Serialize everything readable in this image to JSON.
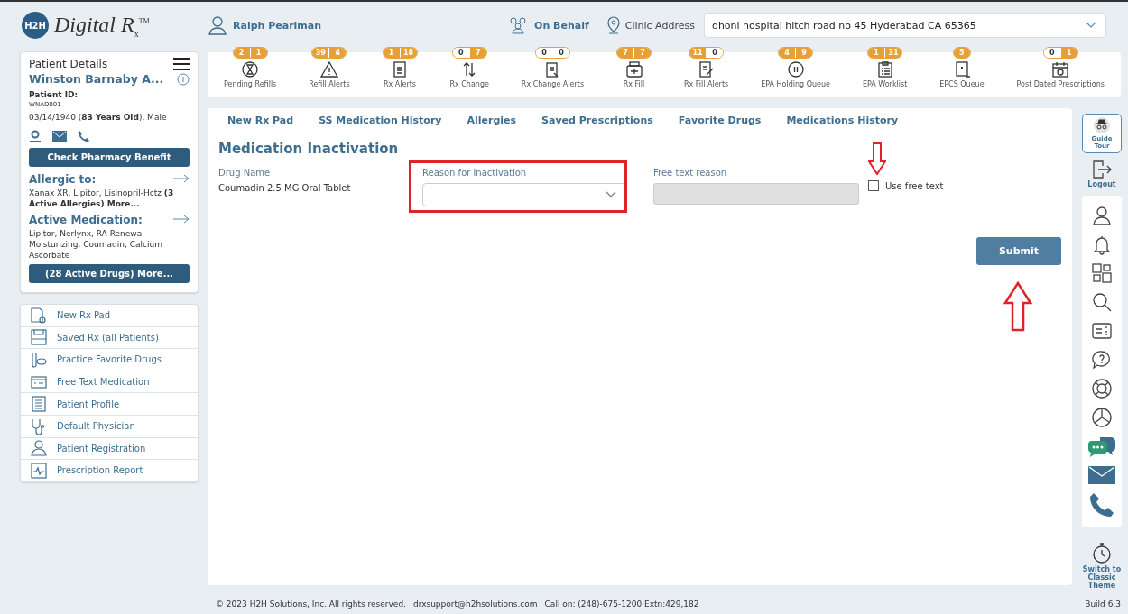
{
  "header": {
    "logo": {
      "badge": "H2H",
      "name": "Digital R",
      "sub": "x",
      "tm": "TM"
    },
    "user": "Ralph Pearlman",
    "on_behalf": "On Behalf",
    "clinic_label": "Clinic Address",
    "clinic": "dhoni hospital hitch road no 45 Hyderabad CA 65365"
  },
  "queues": [
    {
      "label": "Pending Refills",
      "counts": [
        {
          "value": "2",
          "highlighted": true
        },
        {
          "value": "1",
          "highlighted": true
        }
      ]
    },
    {
      "label": "Refill Alerts",
      "counts": [
        {
          "value": "39",
          "highlighted": true
        },
        {
          "value": "4",
          "highlighted": true
        }
      ]
    },
    {
      "label": "Rx Alerts",
      "counts": [
        {
          "value": "1",
          "highlighted": true
        },
        {
          "value": "18",
          "highlighted": true
        }
      ]
    },
    {
      "label": "Rx Change",
      "counts": [
        {
          "value": "0",
          "highlighted": false
        },
        {
          "value": "7",
          "highlighted": true
        }
      ]
    },
    {
      "label": "Rx Change Alerts",
      "counts": [
        {
          "value": "0",
          "highlighted": false
        },
        {
          "value": "0",
          "highlighted": false
        }
      ]
    },
    {
      "label": "Rx Fill",
      "counts": [
        {
          "value": "7",
          "highlighted": true
        },
        {
          "value": "7",
          "highlighted": true
        }
      ]
    },
    {
      "label": "Rx Fill Alerts",
      "counts": [
        {
          "value": "11",
          "highlighted": true
        },
        {
          "value": "0",
          "highlighted": false
        }
      ]
    },
    {
      "label": "EPA Holding Queue",
      "counts": [
        {
          "value": "4",
          "highlighted": true
        },
        {
          "value": "9",
          "highlighted": true
        }
      ]
    },
    {
      "label": "EPA Worklist",
      "counts": [
        {
          "value": "1",
          "highlighted": true
        },
        {
          "value": "31",
          "highlighted": true
        }
      ]
    },
    {
      "label": "EPCS Queue",
      "counts": [
        {
          "value": "5",
          "highlighted": true
        }
      ]
    },
    {
      "label": "Post Dated Prescriptions",
      "counts": [
        {
          "value": "0",
          "highlighted": false
        },
        {
          "value": "1",
          "highlighted": true
        }
      ]
    }
  ],
  "patient": {
    "title": "Patient Details",
    "name": "Winston Barnaby A...",
    "id_label": "Patient ID:",
    "id": "WNAD001",
    "info": "03/14/1940 (**83 Years Old**), Male",
    "benefit_button": "Check Pharmacy Benefit",
    "allergy_title": "Allergic to:",
    "allergies": "Xanax XR, Lipitor, Lisinopril-Hctz **(3 Active Allergies) More...**",
    "meds_title": "Active Medication:",
    "meds": "Lipitor, Nerlynx, RA Renewal Moisturizing, Coumadin, Calcium Ascorbate",
    "meds_button": "(28 Active Drugs) More..."
  },
  "menu": [
    "New Rx Pad",
    "Saved Rx (all Patients)",
    "Practice Favorite Drugs",
    "Free Text Medication",
    "Patient Profile",
    "Default Physician",
    "Patient Registration",
    "Prescription Report"
  ],
  "tabs": [
    {
      "label": "New Rx Pad",
      "selected": false
    },
    {
      "label": "SS Medication History",
      "selected": false
    },
    {
      "label": "Allergies",
      "selected": false
    },
    {
      "label": "Saved Prescriptions",
      "selected": false
    },
    {
      "label": "Favorite Drugs",
      "selected": false
    },
    {
      "label": "Medications History",
      "selected": false
    }
  ],
  "form": {
    "title": "Medication Inactivation",
    "drug_label": "Drug Name",
    "drug": "Coumadin 2.5 MG Oral Tablet",
    "reason_label": "Reason for inactivation",
    "free_label": "Free text reason",
    "free_disabled": true,
    "use_free_text": {
      "label": "Use free text",
      "checked": false
    },
    "submit": "Submit"
  },
  "rail": {
    "guide": "Guide Tour",
    "logout": "Logout",
    "classic": "Switch to Classic Theme"
  },
  "footer": {
    "copyright": "© 2023 H2H Solutions, Inc. All rights reserved.",
    "email": "drxsupport@h2hsolutions.com",
    "phone": "Call on: (248)-675-1200 Extn:429,182",
    "build": "Build 6.3"
  }
}
